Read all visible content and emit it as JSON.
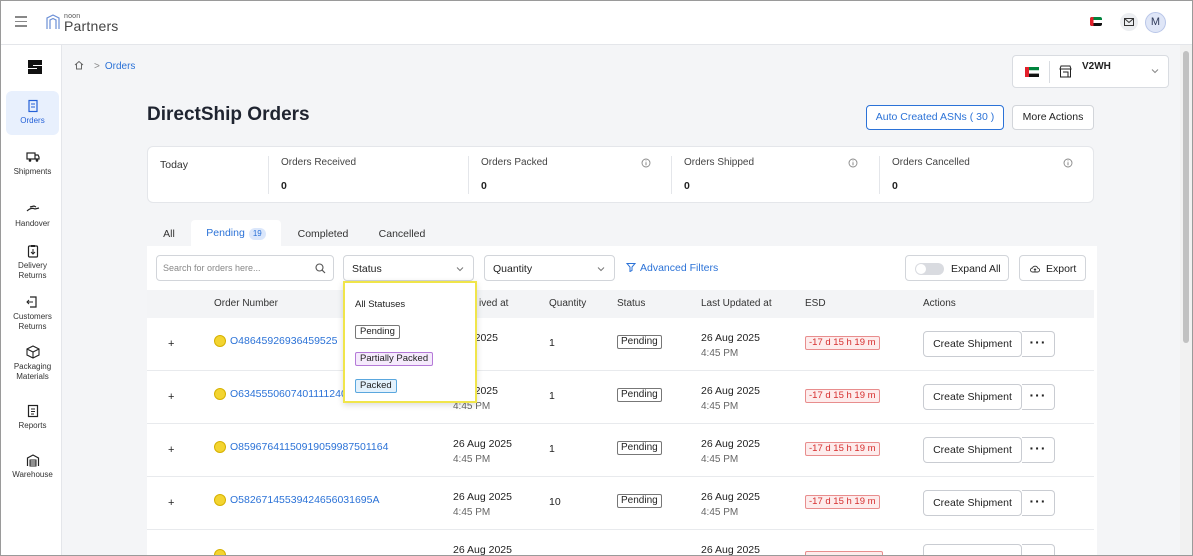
{
  "header": {
    "logo_small": "noon",
    "logo_big": "Partners",
    "avatar_initial": "M"
  },
  "sidebar": {
    "items": [
      {
        "label": "Orders",
        "icon": "orders-icon",
        "active": true
      },
      {
        "label": "Shipments",
        "icon": "truck-icon"
      },
      {
        "label": "Handover",
        "icon": "handover-icon"
      },
      {
        "label": "Delivery Returns",
        "icon": "delivery-returns-icon"
      },
      {
        "label": "Customers Returns",
        "icon": "customer-returns-icon"
      },
      {
        "label": "Packaging Materials",
        "icon": "box-icon"
      },
      {
        "label": "Reports",
        "icon": "reports-icon"
      },
      {
        "label": "Warehouse",
        "icon": "warehouse-icon"
      }
    ]
  },
  "breadcrumb": {
    "current": "Orders"
  },
  "warehouse_selector": {
    "label": "V2WH"
  },
  "page": {
    "title": "DirectShip Orders"
  },
  "actions": {
    "auto_asns": "Auto Created ASNs ( 30 )",
    "more": "More Actions"
  },
  "stats": {
    "today": "Today",
    "items": [
      {
        "label": "Orders Received",
        "value": "0"
      },
      {
        "label": "Orders Packed",
        "value": "0"
      },
      {
        "label": "Orders Shipped",
        "value": "0"
      },
      {
        "label": "Orders Cancelled",
        "value": "0"
      }
    ]
  },
  "tabs": [
    {
      "label": "All"
    },
    {
      "label": "Pending",
      "count": "19",
      "active": true
    },
    {
      "label": "Completed"
    },
    {
      "label": "Cancelled"
    }
  ],
  "filters": {
    "search_placeholder": "Search for orders here...",
    "status": "Status",
    "quantity": "Quantity",
    "advanced": "Advanced Filters",
    "expand_all": "Expand All",
    "export": "Export"
  },
  "status_menu": {
    "all": "All Statuses",
    "pending": "Pending",
    "partial": "Partially Packed",
    "packed": "Packed"
  },
  "table": {
    "headers": {
      "order_number": "Order Number",
      "received_at": "ived at",
      "quantity": "Quantity",
      "status": "Status",
      "last_updated": "Last Updated at",
      "esd": "ESD",
      "actions": "Actions"
    },
    "rows": [
      {
        "order": "O48645926936459525",
        "rcv_date": "Aug 2025",
        "rcv_time": "PM",
        "qty": "1",
        "status": "Pending",
        "upd_date": "26 Aug 2025",
        "upd_time": "4:45 PM",
        "esd": "-17 d 15 h 19 m"
      },
      {
        "order": "O63455506074011112406",
        "rcv_date": "Aug 2025",
        "rcv_time": "4:45 PM",
        "qty": "1",
        "status": "Pending",
        "upd_date": "26 Aug 2025",
        "upd_time": "4:45 PM",
        "esd": "-17 d 15 h 19 m"
      },
      {
        "order": "O85967641150919059987501164",
        "rcv_date": "26 Aug 2025",
        "rcv_time": "4:45 PM",
        "qty": "1",
        "status": "Pending",
        "upd_date": "26 Aug 2025",
        "upd_time": "4:45 PM",
        "esd": "-17 d 15 h 19 m"
      },
      {
        "order": "O58267145539424656031695A",
        "rcv_date": "26 Aug 2025",
        "rcv_time": "4:45 PM",
        "qty": "10",
        "status": "Pending",
        "upd_date": "26 Aug 2025",
        "upd_time": "4:45 PM",
        "esd": "-17 d 15 h 19 m"
      },
      {
        "order": "",
        "rcv_date": "26 Aug 2025",
        "rcv_time": "",
        "qty": "",
        "status": "",
        "upd_date": "26 Aug 2025",
        "upd_time": "",
        "esd": ""
      }
    ],
    "create_label": "Create Shipment",
    "more_label": "···"
  },
  "colors": {
    "accent": "#2b72d7",
    "highlight": "#f0e54a",
    "danger": "#d62f2f"
  }
}
